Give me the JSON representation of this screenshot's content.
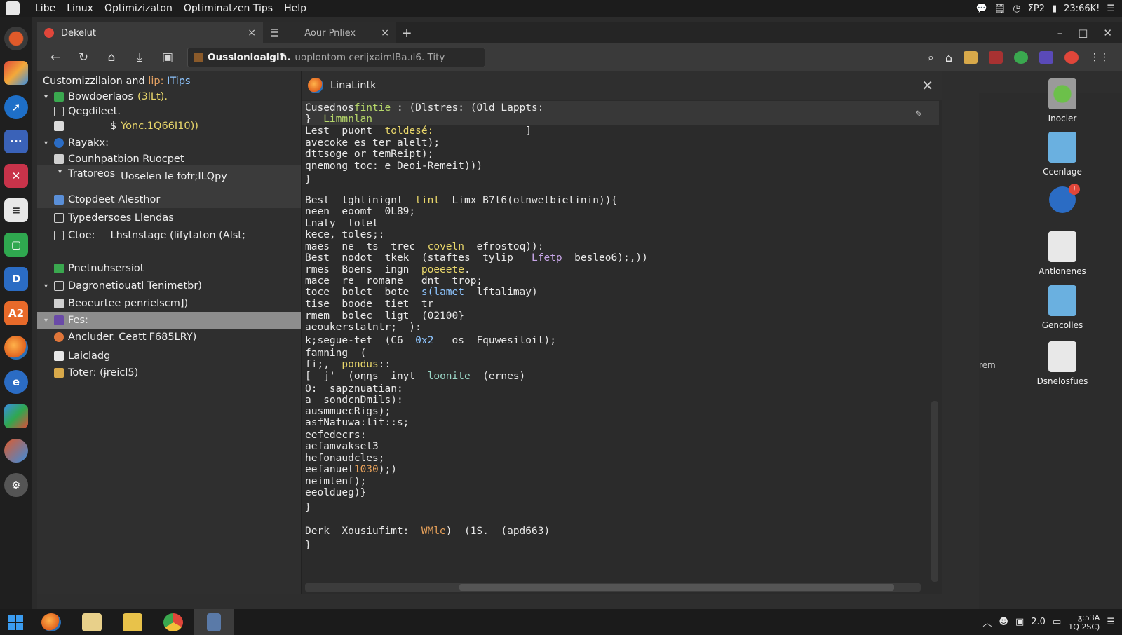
{
  "menubar": {
    "items": [
      "Libe",
      "Linux",
      "Optimizizaton",
      "Optiminatzen Tips",
      "Help"
    ],
    "clock": "23:66K!",
    "tray_text": "ΣΡ2"
  },
  "tabs": [
    {
      "label": "Dekelut",
      "close": "×"
    },
    {
      "label": "Aour Pnliex",
      "close": "×"
    }
  ],
  "new_tab": "+",
  "window_controls": {
    "minimize": "–",
    "maximize": "□",
    "close": "✕"
  },
  "address": {
    "site": "Ousslonioalgiħ.",
    "path": "uoplontom cerijxaimlBa.ıl6. Tity"
  },
  "sidebar": {
    "title_a": "Customizzilaion and",
    "title_b": "lip:",
    "title_c": "ITips",
    "items": [
      {
        "caret": "▾",
        "label": "Bowdoerlaos",
        "extra": "(3lLt).",
        "icon": "green-square-icon"
      },
      {
        "caret": "",
        "label": "Qegdileet.",
        "extra": "",
        "icon": "check-square-icon"
      },
      {
        "caret": "",
        "label": "$",
        "extra": "Yonc.1Q66I10))",
        "icon": "file-icon"
      },
      {
        "caret": "▾",
        "label": "Rayakx:",
        "extra": "",
        "icon": "globe-icon"
      },
      {
        "caret": "",
        "label": "Counhpatbion Ruocpet",
        "extra": "",
        "icon": "doc-icon"
      },
      {
        "caret": "▾",
        "label": "Tratoreos",
        "extra": "Uoselen le fofr;ILQpy",
        "icon": ""
      },
      {
        "caret": "",
        "label": "Ctopdeet Alesthor",
        "extra": "",
        "icon": "image-icon"
      },
      {
        "caret": "",
        "label": "Typedersoes Llendas",
        "extra": "",
        "icon": "check-square-icon"
      },
      {
        "caret": "",
        "label": "Ctoe:",
        "extra": "Lhstnstage (lifytaton (Alst;",
        "icon": "edit-icon"
      },
      {
        "caret": "",
        "label": "Pnetnuhsersiot",
        "extra": "",
        "icon": "image-icon"
      },
      {
        "caret": "▾",
        "label": "Dagronetiouatl Tenimetbr)",
        "extra": "",
        "icon": "edit-icon"
      },
      {
        "caret": "",
        "label": "Beoeurtee penrielscm])",
        "extra": "",
        "icon": "grid-icon"
      },
      {
        "caret": "▾",
        "label": "Fes:",
        "extra": "",
        "icon": "folder-icon"
      },
      {
        "caret": "",
        "label": "Ancluder. Ceatt",
        "extra": "F685LRY)",
        "icon": "gear-icon"
      },
      {
        "caret": "",
        "label": "Laicladg",
        "extra": "",
        "icon": "pdf-icon"
      },
      {
        "caret": "",
        "label": "Toter: (ɉreicl5)",
        "extra": "",
        "icon": "image-icon"
      }
    ]
  },
  "panel": {
    "title": "LinaLintk",
    "close": "✕",
    "code": [
      [
        "Cusednos",
        "fintie",
        " : (Dlstres: (Old Lappts:"
      ],
      [
        "}  ",
        "Limmnlan",
        ""
      ],
      [
        "Lest  puont  ",
        "toldesé:",
        "               ]"
      ],
      [
        "avecoke es ter alelt);",
        "",
        ""
      ],
      [
        "dttsoge or temReipt);",
        "",
        ""
      ],
      [
        "qnemong toc: e Deoi-Remeit)))",
        "",
        ""
      ],
      [
        "}",
        "",
        ""
      ],
      [
        "Best  lghtinignt  ",
        "tinl",
        "  Limx B7l6(olnwetbielinin)){"
      ],
      [
        "neen  eoomt  0L89;",
        "",
        ""
      ],
      [
        "Lnaty  tolet",
        "",
        ""
      ],
      [
        "kece, toles;:",
        "",
        ""
      ],
      [
        "maes  ne  ts  trec  ",
        "coveln",
        "  efrostoq)):"
      ],
      [
        "Best  nodot  tkek  (staftes  tylip   ",
        "Lfetp",
        "  besleo6);,))"
      ],
      [
        "rmes  Boens  ingn  ",
        "poeeete",
        "."
      ],
      [
        "mace  re  romane   dnt  trop;",
        "",
        ""
      ],
      [
        "toce  bolet  bote  ",
        "s(lamet",
        "  lftalimay)"
      ],
      [
        "tise  boode  tiet  tr",
        "",
        ""
      ],
      [
        "rmem  bolec  ligt  (02100}",
        "",
        ""
      ],
      [
        "aeoukerstatntr;  ):",
        "",
        ""
      ],
      [
        "k;segue-tet  (C6  ",
        "0ɤ2",
        "   os  Fquwesiloil);"
      ],
      [
        "famning  (",
        "",
        ""
      ],
      [
        "fi;,  ",
        "pondus",
        "::"
      ],
      [
        "[  j'  (oƞƞs  inyt  ",
        "loonite",
        "  (ernes)"
      ],
      [
        "O:  sapznuatian:",
        "",
        ""
      ],
      [
        "a  sondcnDmils):",
        "",
        ""
      ],
      [
        "ausmmuecRigs);",
        "",
        ""
      ],
      [
        "asfNatuwa:lit:",
        "",
        ":s;"
      ],
      [
        "eefedecrs:",
        "",
        ""
      ],
      [
        "aefamvaksel3",
        "",
        ""
      ],
      [
        "hefonaudcles;",
        "",
        ""
      ],
      [
        "eefanuet",
        "1030",
        ");)"
      ],
      [
        "neimlenf);",
        "",
        ""
      ],
      [
        "eeoldueg",
        "",
        ")}"
      ],
      [
        "}",
        "",
        ""
      ],
      [
        "Derk  Xousiufimt:  ",
        "WMle",
        ")  (1S.  (apd663)"
      ],
      [
        "}",
        "",
        ""
      ]
    ]
  },
  "desktop": {
    "stray": "rem",
    "icons": [
      {
        "label": "Inocler",
        "icon": "gear-app-icon"
      },
      {
        "label": "Ccenlage",
        "icon": "folder-check-icon"
      },
      {
        "label": "",
        "icon": "edge-icon",
        "badge": "!"
      },
      {
        "label": "Antlonenes",
        "icon": "document-icon"
      },
      {
        "label": "Gencolles",
        "icon": "folder-icon"
      },
      {
        "label": "Dsnelosfues",
        "icon": "pdf-doc-icon"
      }
    ]
  },
  "taskbar": {
    "tray_num": "2.0",
    "time": "ᵹ:53A",
    "date": "1Q 2SC)"
  }
}
